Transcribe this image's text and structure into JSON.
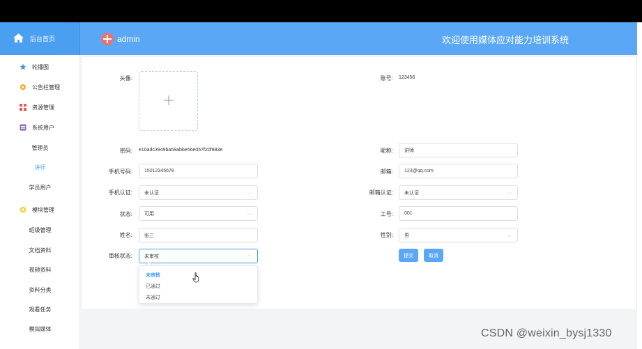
{
  "header": {
    "home_label": "后台首页",
    "user_name": "admin",
    "system_title": "欢迎使用媒体应对能力培训系统"
  },
  "sidebar": {
    "items": [
      {
        "label": "轮播图",
        "icon": "star-icon",
        "color": "#4a90e2"
      },
      {
        "label": "公告栏管理",
        "icon": "bell-icon",
        "color": "#f5a623"
      },
      {
        "label": "资源管理",
        "icon": "grid-icon",
        "color": "#e85a4f"
      },
      {
        "label": "系统用户",
        "icon": "user-box-icon",
        "color": "#8e6bc4"
      }
    ],
    "subitems_users": [
      "管理员",
      "讲师",
      "学员用户"
    ],
    "module_item": {
      "label": "模块管理",
      "icon": "gear-icon",
      "color": "#f8d03c"
    },
    "subitems_modules": [
      "班级管理",
      "文档资料",
      "视频资料",
      "资料分类",
      "观看任务",
      "模拟媒体"
    ],
    "active_sub": "讲师"
  },
  "form": {
    "avatar_label": "头像:",
    "account_label": "账号:",
    "account_value": "123456",
    "password_label": "密码:",
    "password_value": "e10adc3949ba59abbe56e057f20f883e",
    "nickname_label": "昵称:",
    "nickname_value": "讲师",
    "phone_label": "手机号码:",
    "phone_value": "15012345678",
    "email_label": "邮箱:",
    "email_value": "123@qq.com",
    "phone_verify_label": "手机认证:",
    "phone_verify_value": "未认证",
    "email_verify_label": "邮箱认证:",
    "email_verify_value": "未认证",
    "status_label": "状态:",
    "status_value": "可用",
    "job_no_label": "工号:",
    "job_no_value": "001",
    "name_label": "姓名:",
    "name_value": "张三",
    "gender_label": "性别:",
    "gender_value": "男",
    "audit_label": "审核状态:",
    "audit_value": "未审核",
    "submit_label": "提交",
    "cancel_label": "取消"
  },
  "audit_dropdown": {
    "options": [
      "未审核",
      "已通过",
      "未通过"
    ],
    "selected": "未审核"
  },
  "watermark": "CSDN @weixin_bysj1330",
  "colors": {
    "accent": "#5aa8f5",
    "header_home": "#4a9ff0"
  }
}
